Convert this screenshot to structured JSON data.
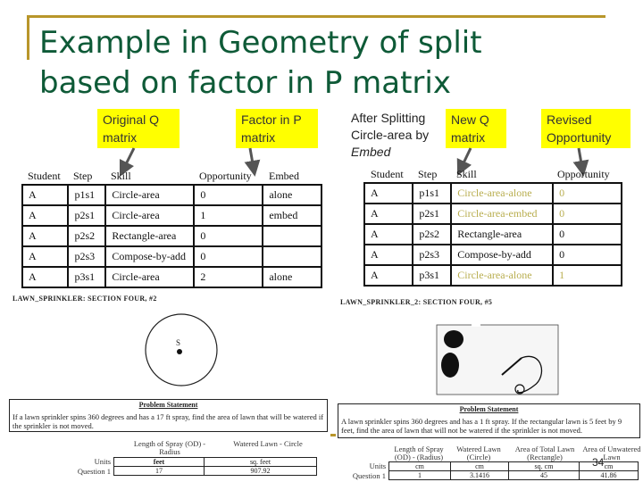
{
  "slide": {
    "title_line1": "Example in Geometry of split",
    "title_line2": "based on factor in P matrix",
    "page_number": "34",
    "colors": {
      "title": "#0e5a37",
      "accent": "#b8962a",
      "callout_bg": "#ffff00",
      "highlight_text": "#b9ae50"
    }
  },
  "callouts": {
    "original_q": {
      "line1": "Original Q",
      "line2": "matrix"
    },
    "factor_p": {
      "line1": "Factor in P",
      "line2": "matrix"
    },
    "after_split": {
      "line1": "After Splitting",
      "line2": "Circle-area by",
      "line3": "Embed"
    },
    "new_q": {
      "line1": "New Q",
      "line2": "matrix"
    },
    "revised_opp": {
      "line1": "Revised",
      "line2": "Opportunity"
    }
  },
  "left_table": {
    "headers": [
      "Student",
      "Step",
      "Skill",
      "Opportunity",
      "Embed"
    ],
    "rows": [
      [
        "A",
        "p1s1",
        "Circle-area",
        "0",
        "alone"
      ],
      [
        "A",
        "p2s1",
        "Circle-area",
        "1",
        "embed"
      ],
      [
        "A",
        "p2s2",
        "Rectangle-area",
        "0",
        ""
      ],
      [
        "A",
        "p2s3",
        "Compose-by-add",
        "0",
        ""
      ],
      [
        "A",
        "p3s1",
        "Circle-area",
        "2",
        "alone"
      ]
    ]
  },
  "right_table": {
    "headers": [
      "Student",
      "Step",
      "Skill",
      "Opportunity"
    ],
    "rows": [
      [
        "A",
        "p1s1",
        "Circle-area-alone",
        "0"
      ],
      [
        "A",
        "p2s1",
        "Circle-area-embed",
        "0"
      ],
      [
        "A",
        "p2s2",
        "Rectangle-area",
        "0"
      ],
      [
        "A",
        "p2s3",
        "Compose-by-add",
        "0"
      ],
      [
        "A",
        "p3s1",
        "Circle-area-alone",
        "1"
      ]
    ],
    "highlighted_rows": [
      0,
      1,
      4
    ]
  },
  "left_problem": {
    "label": "LAWN_SPRINKLER: SECTION FOUR, #2",
    "figure_label": "S",
    "statement_title": "Problem Statement",
    "statement": "If a lawn sprinkler spins 360 degrees and has a 17 ft spray, find the area of lawn that will be watered if the sprinkler is not moved.",
    "col_headers": [
      "Length of Spray (OD) - Radius",
      "Watered Lawn - Circle"
    ],
    "row_labels": [
      "Units",
      "Question 1"
    ],
    "units": [
      "feet",
      "sq. feet"
    ],
    "answers": [
      "17",
      "907.92"
    ]
  },
  "right_problem": {
    "label": "LAWN_SPRINKLER_2: SECTION FOUR, #5",
    "statement_title": "Problem Statement",
    "statement": "A lawn sprinkler spins 360 degrees and has a 1 ft spray.  If the rectangular lawn is 5 feet by 9 feet,  find the area of lawn that will not be watered if the sprinkler is not moved.",
    "col_headers": [
      "Length of Spray (OD) - (Radius)",
      "Watered Lawn (Circle)",
      "Area of Total Lawn (Rectangle)",
      "Area of Unwatered Lawn"
    ],
    "row_labels": [
      "Units",
      "Question 1"
    ],
    "units": [
      "cm",
      "cm",
      "sq. cm",
      "cm"
    ],
    "answers": [
      "1",
      "3.1416",
      "45",
      "41.86"
    ]
  }
}
